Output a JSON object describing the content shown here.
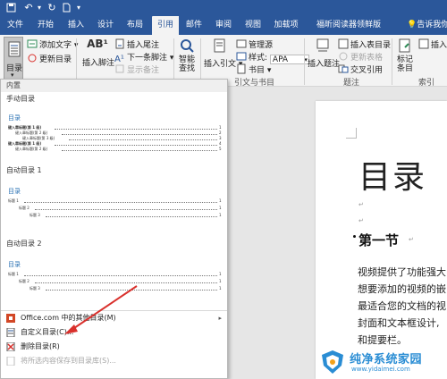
{
  "colors": {
    "brand": "#2b579a",
    "accent_red": "#d9302c",
    "heading_blue": "#2e74b5",
    "watermark_blue": "#2a8dd4"
  },
  "quick_access": [
    {
      "name": "save-icon",
      "glyph": "💾"
    },
    {
      "name": "undo-icon",
      "glyph": "↶"
    },
    {
      "name": "redo-icon",
      "glyph": "↻"
    },
    {
      "name": "new-doc-icon",
      "glyph": "🗋"
    },
    {
      "name": "customize-qat-icon",
      "glyph": "⏷"
    }
  ],
  "tabs": [
    "文件",
    "开始",
    "插入",
    "设计",
    "布局",
    "引用",
    "邮件",
    "审阅",
    "视图",
    "加载项",
    "福昕阅读器领鲜版"
  ],
  "active_tab": "引用",
  "tell_me": "告诉我你",
  "ribbon": {
    "toc_button": "目录",
    "add_text": "添加文字",
    "update_toc": "更新目录",
    "insert_footnote": "插入脚注",
    "insert_endnote": "插入尾注",
    "next_footnote": "下一条脚注",
    "show_notes": "显示备注",
    "smart_lookup": "智能\n查找",
    "insert_citation": "插入引文",
    "manage_sources": "管理源",
    "style_label": "样式:",
    "style_value": "APA",
    "bibliography": "书目",
    "insert_caption": "插入题注",
    "insert_table_of_figures": "插入表目录",
    "update_table": "更新表格",
    "cross_reference": "交叉引用",
    "mark_entry": "标记\n条目",
    "insert_index": "插入索",
    "group_citations": "引文与书目",
    "group_captions": "题注",
    "group_index": "索引"
  },
  "toc_panel": {
    "header": "内置",
    "sections": [
      {
        "title": "手动目录",
        "preview_title": "目录",
        "lines": [
          {
            "text": "键入章标题(第 1 级)",
            "num": "1",
            "indent": 0,
            "bold": true
          },
          {
            "text": "键入章标题(第 2 级)",
            "num": "2",
            "indent": 1,
            "bold": false
          },
          {
            "text": "键入章标题(第 3 级)",
            "num": "3",
            "indent": 2,
            "bold": false
          },
          {
            "text": "键入章标题(第 1 级)",
            "num": "4",
            "indent": 0,
            "bold": true
          },
          {
            "text": "键入章标题(第 2 级)",
            "num": "5",
            "indent": 1,
            "bold": false
          }
        ]
      },
      {
        "title": "自动目录 1",
        "preview_title": "目录",
        "lines": [
          {
            "text": "标题 1",
            "num": "1",
            "indent": 0,
            "bold": false
          },
          {
            "text": "标题 2",
            "num": "1",
            "indent": 1,
            "bold": false
          },
          {
            "text": "标题 3",
            "num": "1",
            "indent": 2,
            "bold": false
          }
        ]
      },
      {
        "title": "自动目录 2",
        "preview_title": "目录",
        "lines": [
          {
            "text": "标题 1",
            "num": "1",
            "indent": 0,
            "bold": false
          },
          {
            "text": "标题 2",
            "num": "1",
            "indent": 1,
            "bold": false
          },
          {
            "text": "标题 3",
            "num": "1",
            "indent": 2,
            "bold": false
          }
        ]
      }
    ],
    "menu": [
      {
        "label": "Office.com 中的其他目录(M)",
        "disabled": false,
        "has_submenu": true,
        "icon": "office-icon"
      },
      {
        "label": "自定义目录(C)...",
        "disabled": false,
        "has_submenu": false,
        "icon": "custom-toc-icon"
      },
      {
        "label": "删除目录(R)",
        "disabled": false,
        "has_submenu": false,
        "icon": "remove-toc-icon"
      },
      {
        "label": "将所选内容保存到目录库(S)...",
        "disabled": true,
        "has_submenu": false,
        "icon": "save-selection-icon"
      }
    ]
  },
  "document": {
    "title": "目录",
    "heading": "第一节",
    "paragraph_lines": [
      "视频提供了功能强大",
      "想要添加的视频的嵌",
      "最适合您的文档的视",
      "封面和文本框设计,",
      "和提要栏。"
    ],
    "return_mark": "↵"
  },
  "watermark": {
    "name": "纯净系统家园",
    "url": "www.yidaimei.com"
  }
}
